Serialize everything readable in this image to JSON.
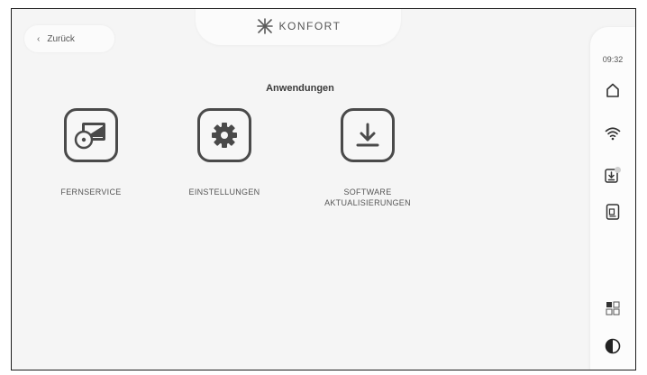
{
  "header": {
    "back_label": "Zurück",
    "brand": "KONFORT"
  },
  "section": {
    "title": "Anwendungen"
  },
  "apps": [
    {
      "label": "FERNSERVICE",
      "icon": "remote-service-icon"
    },
    {
      "label": "EINSTELLUNGEN",
      "icon": "gear-icon"
    },
    {
      "label": "SOFTWARE\nAKTUALISIERUNGEN",
      "icon": "download-icon"
    }
  ],
  "sidebar": {
    "time": "09:32",
    "icons": [
      "home-icon",
      "wifi-icon",
      "software-update-icon",
      "document-icon",
      "grid-layout-icon",
      "contrast-icon"
    ]
  },
  "colors": {
    "frame_border": "#1e1e1e",
    "background": "#f5f5f5",
    "icon_stroke": "#4a4a4a"
  }
}
